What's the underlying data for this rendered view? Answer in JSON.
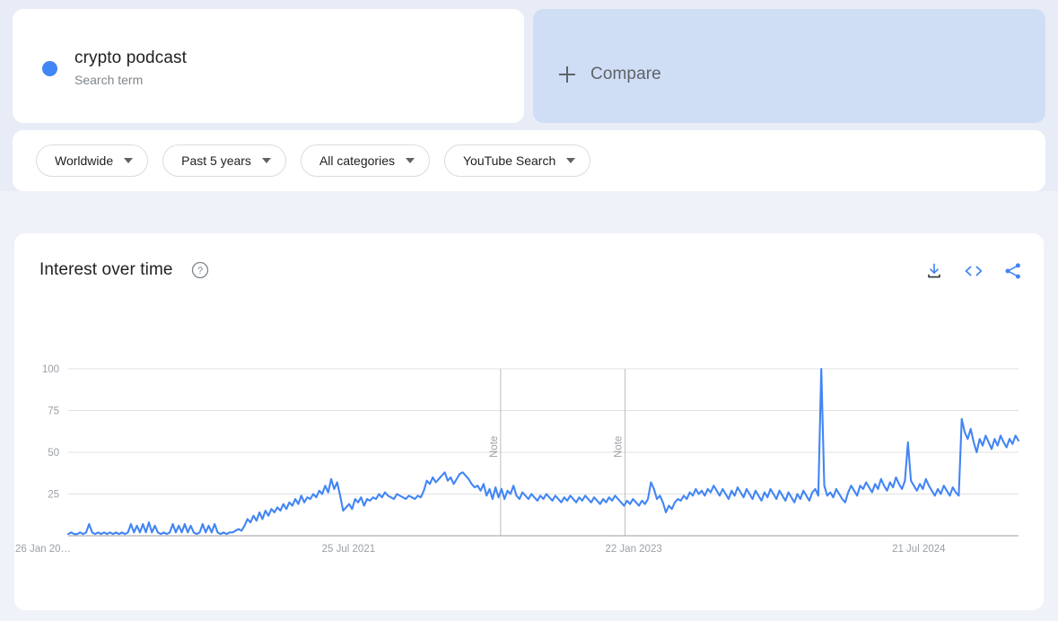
{
  "search_card": {
    "term": "crypto podcast",
    "type_label": "Search term",
    "dot_color": "#4285f4"
  },
  "compare_card": {
    "label": "Compare",
    "plus_icon": "plus-icon",
    "background": "#cfdef5"
  },
  "filters": [
    {
      "label": "Worldwide",
      "icon": "chevron-down-icon"
    },
    {
      "label": "Past 5 years",
      "icon": "chevron-down-icon"
    },
    {
      "label": "All categories",
      "icon": "chevron-down-icon"
    },
    {
      "label": "YouTube Search",
      "icon": "chevron-down-icon"
    }
  ],
  "chart_panel": {
    "title": "Interest over time",
    "help_icon": "help-circle-icon",
    "tools": [
      {
        "name": "download-icon",
        "title": "Download"
      },
      {
        "name": "embed-code-icon",
        "title": "Embed"
      },
      {
        "name": "share-icon",
        "title": "Share"
      }
    ]
  },
  "chart_data": {
    "type": "line",
    "title": "Interest over time",
    "xlabel": "",
    "ylabel": "",
    "ylim": [
      0,
      100
    ],
    "yticks": [
      25,
      50,
      75,
      100
    ],
    "grid": true,
    "legend": false,
    "line_color": "#4285f4",
    "xtick_labels": [
      "26 Jan 20…",
      "25 Jul 2021",
      "22 Jan 2023",
      "21 Jul 2024"
    ],
    "xtick_positions": [
      0.0,
      0.295,
      0.595,
      0.895
    ],
    "annotations": [
      {
        "label": "Note",
        "x": 0.455
      },
      {
        "label": "Note",
        "x": 0.586
      }
    ],
    "series": [
      {
        "name": "crypto podcast",
        "values": [
          1,
          2,
          1,
          1,
          2,
          1,
          2,
          7,
          2,
          1,
          2,
          1,
          2,
          1,
          2,
          1,
          2,
          1,
          2,
          1,
          2,
          7,
          2,
          6,
          2,
          7,
          2,
          8,
          2,
          6,
          2,
          1,
          2,
          1,
          2,
          7,
          2,
          6,
          2,
          7,
          2,
          6,
          2,
          1,
          2,
          7,
          2,
          6,
          2,
          7,
          2,
          1,
          2,
          1,
          2,
          2,
          3,
          4,
          3,
          6,
          10,
          8,
          12,
          9,
          14,
          10,
          15,
          12,
          16,
          14,
          17,
          15,
          19,
          16,
          20,
          18,
          22,
          19,
          24,
          20,
          23,
          22,
          25,
          23,
          27,
          25,
          30,
          26,
          34,
          28,
          32,
          24,
          15,
          17,
          19,
          16,
          22,
          20,
          23,
          18,
          22,
          21,
          23,
          22,
          25,
          23,
          26,
          24,
          23,
          22,
          25,
          24,
          23,
          22,
          24,
          23,
          22,
          24,
          23,
          27,
          33,
          31,
          35,
          32,
          34,
          36,
          38,
          33,
          35,
          31,
          34,
          37,
          38,
          36,
          34,
          31,
          29,
          30,
          27,
          31,
          24,
          28,
          22,
          29,
          23,
          28,
          22,
          27,
          25,
          30,
          24,
          22,
          26,
          24,
          22,
          25,
          23,
          21,
          24,
          22,
          25,
          23,
          21,
          24,
          22,
          20,
          23,
          21,
          24,
          22,
          20,
          23,
          21,
          24,
          22,
          20,
          23,
          21,
          19,
          22,
          20,
          23,
          21,
          24,
          22,
          20,
          18,
          21,
          19,
          22,
          20,
          18,
          21,
          19,
          22,
          32,
          28,
          22,
          24,
          20,
          14,
          18,
          16,
          20,
          22,
          21,
          24,
          22,
          26,
          24,
          28,
          25,
          27,
          24,
          28,
          26,
          30,
          27,
          24,
          28,
          25,
          22,
          27,
          24,
          29,
          26,
          23,
          28,
          25,
          22,
          27,
          24,
          21,
          26,
          23,
          28,
          25,
          22,
          27,
          24,
          21,
          26,
          23,
          20,
          25,
          22,
          27,
          24,
          21,
          26,
          28,
          24,
          100,
          30,
          24,
          26,
          23,
          28,
          25,
          22,
          20,
          26,
          30,
          27,
          24,
          30,
          28,
          32,
          29,
          26,
          31,
          28,
          34,
          30,
          27,
          32,
          29,
          35,
          31,
          28,
          33,
          56,
          33,
          30,
          27,
          31,
          28,
          34,
          30,
          27,
          24,
          28,
          25,
          30,
          27,
          24,
          29,
          26,
          24,
          70,
          62,
          58,
          64,
          56,
          50,
          58,
          54,
          60,
          56,
          52,
          58,
          54,
          60,
          56,
          53,
          58,
          55,
          60,
          57
        ]
      }
    ]
  }
}
